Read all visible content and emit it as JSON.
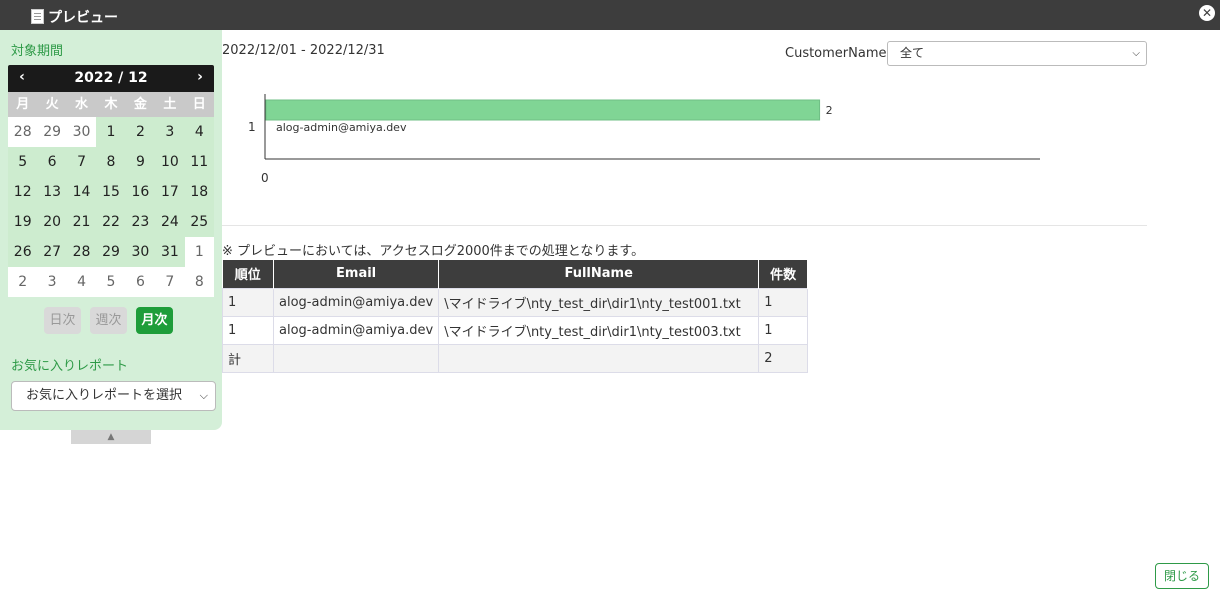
{
  "window": {
    "title": "プレビュー",
    "close_glyph": "✕"
  },
  "left_panel": {
    "period_label": "対象期間",
    "calendar": {
      "month_label": "2022 / 12",
      "prev": "‹",
      "next": "›",
      "weekdays": [
        "月",
        "火",
        "水",
        "木",
        "金",
        "土",
        "日"
      ],
      "weeks": [
        [
          {
            "d": "28",
            "s": "other"
          },
          {
            "d": "29",
            "s": "other"
          },
          {
            "d": "30",
            "s": "other"
          },
          {
            "d": "1",
            "s": "in"
          },
          {
            "d": "2",
            "s": "in"
          },
          {
            "d": "3",
            "s": "in"
          },
          {
            "d": "4",
            "s": "in"
          }
        ],
        [
          {
            "d": "5",
            "s": "in"
          },
          {
            "d": "6",
            "s": "in"
          },
          {
            "d": "7",
            "s": "in"
          },
          {
            "d": "8",
            "s": "in"
          },
          {
            "d": "9",
            "s": "in"
          },
          {
            "d": "10",
            "s": "in"
          },
          {
            "d": "11",
            "s": "in"
          }
        ],
        [
          {
            "d": "12",
            "s": "in"
          },
          {
            "d": "13",
            "s": "in"
          },
          {
            "d": "14",
            "s": "in"
          },
          {
            "d": "15",
            "s": "in"
          },
          {
            "d": "16",
            "s": "in"
          },
          {
            "d": "17",
            "s": "in"
          },
          {
            "d": "18",
            "s": "in"
          }
        ],
        [
          {
            "d": "19",
            "s": "in"
          },
          {
            "d": "20",
            "s": "in"
          },
          {
            "d": "21",
            "s": "in"
          },
          {
            "d": "22",
            "s": "in"
          },
          {
            "d": "23",
            "s": "in"
          },
          {
            "d": "24",
            "s": "in"
          },
          {
            "d": "25",
            "s": "in"
          }
        ],
        [
          {
            "d": "26",
            "s": "in"
          },
          {
            "d": "27",
            "s": "in"
          },
          {
            "d": "28",
            "s": "in"
          },
          {
            "d": "29",
            "s": "in"
          },
          {
            "d": "30",
            "s": "in"
          },
          {
            "d": "31",
            "s": "in"
          },
          {
            "d": "1",
            "s": "other"
          }
        ],
        [
          {
            "d": "2",
            "s": "other"
          },
          {
            "d": "3",
            "s": "other"
          },
          {
            "d": "4",
            "s": "other"
          },
          {
            "d": "5",
            "s": "other"
          },
          {
            "d": "6",
            "s": "other"
          },
          {
            "d": "7",
            "s": "other"
          },
          {
            "d": "8",
            "s": "other"
          }
        ]
      ]
    },
    "period_buttons": {
      "daily": "日次",
      "weekly": "週次",
      "monthly": "月次",
      "active": "monthly"
    },
    "favorites_label": "お気に入りレポート",
    "favorites_select": "お気に入りレポートを選択",
    "collapse_glyph": "▲"
  },
  "main": {
    "date_range": "2022/12/01 - 2022/12/31",
    "customer_label": "CustomerName",
    "customer_value": "全て",
    "note": "※ プレビューにおいては、アクセスログ2000件までの処理となります。",
    "table": {
      "headers": [
        "順位",
        "Email",
        "FullName",
        "件数"
      ],
      "rows": [
        [
          "1",
          "alog-admin@amiya.dev",
          "\\マイドライブ\\nty_test_dir\\dir1\\nty_test001.txt",
          "1"
        ],
        [
          "1",
          "alog-admin@amiya.dev",
          "\\マイドライブ\\nty_test_dir\\dir1\\nty_test003.txt",
          "1"
        ],
        [
          "計",
          "",
          "",
          "2"
        ]
      ]
    },
    "close_button": "閉じる"
  },
  "chart_data": {
    "type": "bar",
    "orientation": "horizontal",
    "categories": [
      "1"
    ],
    "category_sublabels": [
      "alog-admin@amiya.dev"
    ],
    "values": [
      2
    ],
    "x_ticks": [
      "0"
    ],
    "xlim": [
      0,
      2.8
    ],
    "bar_color": "#80d595",
    "grid": false
  },
  "colors": {
    "accent_green": "#1e9d3a",
    "panel_bg": "#d4efd8",
    "titlebar_bg": "#3d3d3d"
  }
}
